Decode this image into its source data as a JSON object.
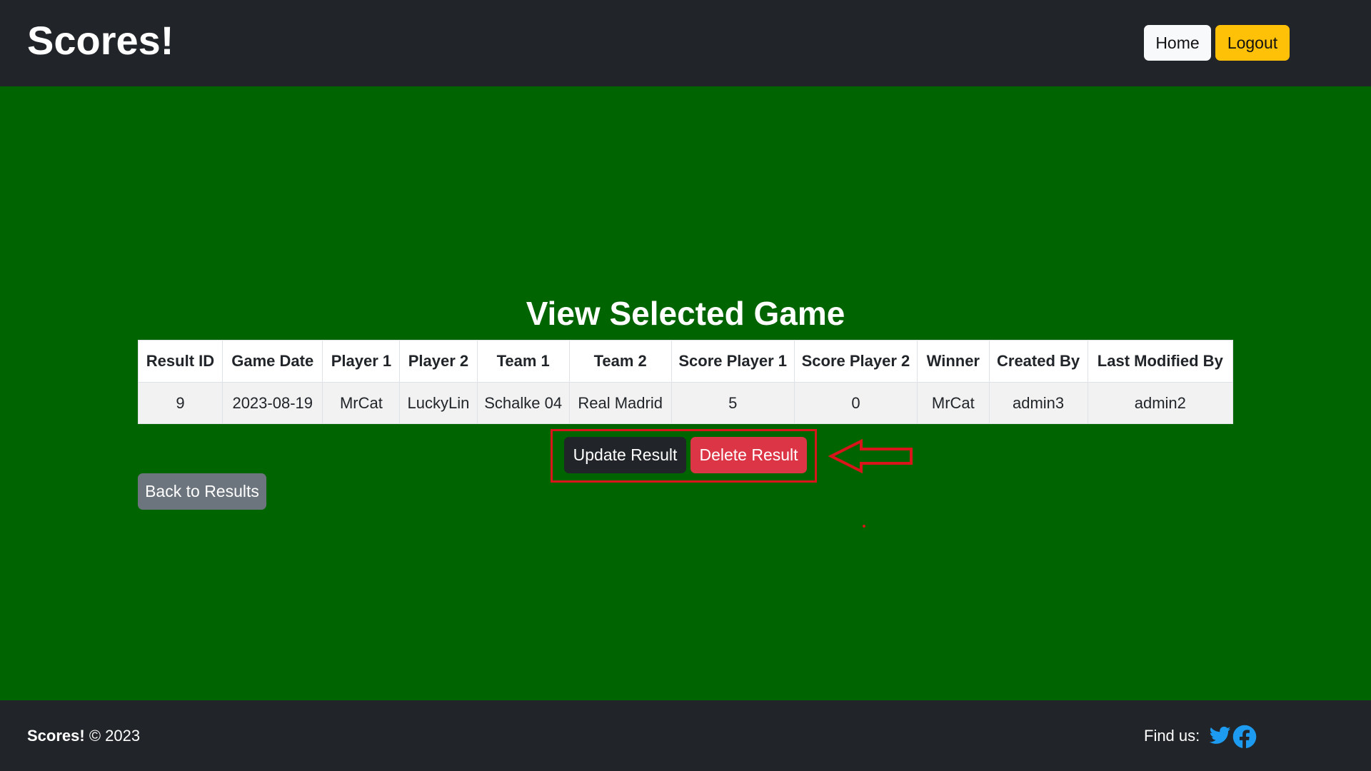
{
  "navbar": {
    "brand": "Scores!",
    "home_label": "Home",
    "logout_label": "Logout"
  },
  "main": {
    "title": "View Selected Game",
    "table": {
      "headers": [
        "Result ID",
        "Game Date",
        "Player 1",
        "Player 2",
        "Team 1",
        "Team 2",
        "Score Player 1",
        "Score Player 2",
        "Winner",
        "Created By",
        "Last Modified By"
      ],
      "row": [
        "9",
        "2023-08-19",
        "MrCat",
        "LuckyLin",
        "Schalke 04",
        "Real Madrid",
        "5",
        "0",
        "MrCat",
        "admin3",
        "admin2"
      ]
    },
    "update_label": "Update Result",
    "delete_label": "Delete Result",
    "back_label": "Back to Results"
  },
  "footer": {
    "brand": "Scores!",
    "copyright": "© 2023",
    "find_us": "Find us:",
    "icons": [
      "twitter-icon",
      "facebook-icon"
    ]
  },
  "colors": {
    "page_bg": "#006400",
    "navbar_bg": "#212529",
    "logout": "#ffc107",
    "delete": "#dc3545",
    "annotation": "#d9141a",
    "social": "#1d9bf0"
  }
}
